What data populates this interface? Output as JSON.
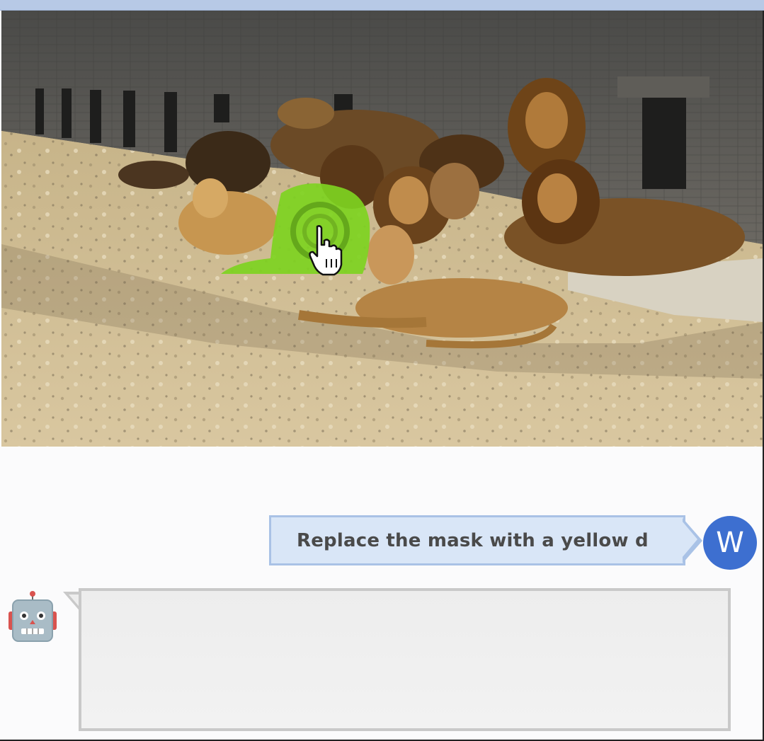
{
  "photo": {
    "subject": "pride of lions resting in front of a brick wall",
    "mask_color": "#7ed321",
    "cursor_icon": "hand-pointer-icon"
  },
  "chat": {
    "user_message": "Replace the mask with a yellow d",
    "user_avatar_letter": "W",
    "user_avatar_color": "#3d6fd0",
    "bot_icon": "robot-icon",
    "bot_message": ""
  }
}
